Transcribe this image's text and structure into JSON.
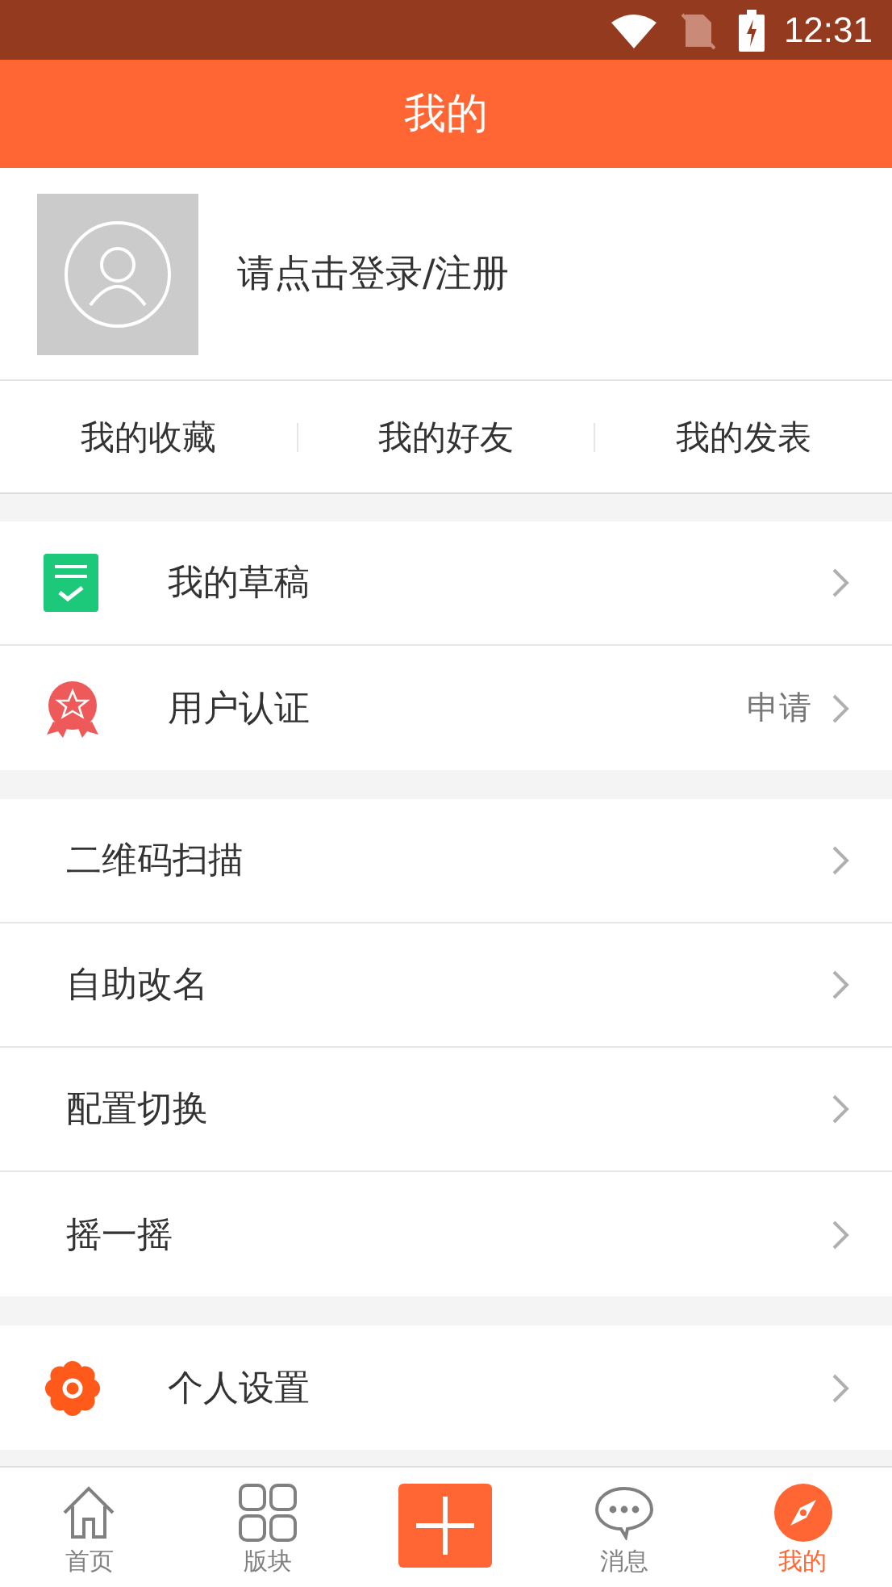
{
  "status_bar": {
    "time": "12:31"
  },
  "header": {
    "title": "我的"
  },
  "profile": {
    "login_prompt": "请点击登录/注册"
  },
  "shortcuts": [
    "我的收藏",
    "我的好友",
    "我的发表"
  ],
  "menu_groups": [
    {
      "items": [
        {
          "kind": "draft",
          "label": "我的草稿"
        },
        {
          "kind": "badge",
          "label": "用户认证",
          "trailing": "申请"
        }
      ]
    },
    {
      "items": [
        {
          "kind": "plain",
          "label": "二维码扫描"
        },
        {
          "kind": "plain",
          "label": "自助改名"
        },
        {
          "kind": "plain",
          "label": "配置切换"
        },
        {
          "kind": "plain",
          "label": "摇一摇"
        }
      ]
    },
    {
      "items": [
        {
          "kind": "gear",
          "label": "个人设置"
        }
      ]
    }
  ],
  "tab_bar": [
    {
      "kind": "home",
      "label": "首页",
      "selected": false
    },
    {
      "kind": "grid",
      "label": "版块",
      "selected": false
    },
    {
      "kind": "add"
    },
    {
      "kind": "chat",
      "label": "消息",
      "selected": false
    },
    {
      "kind": "compass",
      "label": "我的",
      "selected": true
    }
  ]
}
